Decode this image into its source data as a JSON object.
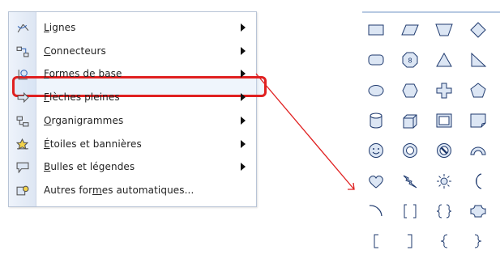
{
  "menu": {
    "items": [
      {
        "label": "Lignes",
        "hotkey": "L",
        "icon": "lines-icon",
        "has_submenu": true
      },
      {
        "label": "Connecteurs",
        "hotkey": "C",
        "icon": "connectors-icon",
        "has_submenu": true
      },
      {
        "label": "Formes de base",
        "hotkey": "F",
        "icon": "basic-shapes-icon",
        "has_submenu": true,
        "selected": true
      },
      {
        "label": "Flèches pleines",
        "hotkey": "F",
        "icon": "block-arrows-icon",
        "has_submenu": true
      },
      {
        "label": "Organigrammes",
        "hotkey": "O",
        "icon": "flowchart-icon",
        "has_submenu": true
      },
      {
        "label": "Étoiles et bannières",
        "hotkey": "É",
        "icon": "stars-banners-icon",
        "has_submenu": true
      },
      {
        "label": "Bulles et légendes",
        "hotkey": "B",
        "icon": "callouts-icon",
        "has_submenu": true
      },
      {
        "label": "Autres formes automatiques...",
        "hotkey": "m",
        "icon": "more-autoshapes-icon",
        "has_submenu": false
      }
    ]
  },
  "highlight_color": "#e02020",
  "palette": {
    "rows": [
      [
        "rectangle",
        "parallelogram",
        "trapezoid",
        "diamond"
      ],
      [
        "rounded-rectangle",
        "octagon",
        "isosceles-triangle",
        "right-triangle"
      ],
      [
        "oval",
        "hexagon",
        "cross",
        "pentagon"
      ],
      [
        "can",
        "cube",
        "bevel",
        "folded-corner"
      ],
      [
        "smiley-face",
        "donut",
        "no-symbol",
        "block-arc"
      ],
      [
        "heart",
        "lightning-bolt",
        "sun",
        "moon"
      ],
      [
        "arc",
        "double-bracket",
        "double-brace",
        "plaque"
      ],
      [
        "left-bracket",
        "right-bracket",
        "left-brace",
        "right-brace"
      ]
    ],
    "octagon_label": "8",
    "stroke_color": "#1f3a6e",
    "fill_color": "#dce6f4"
  }
}
